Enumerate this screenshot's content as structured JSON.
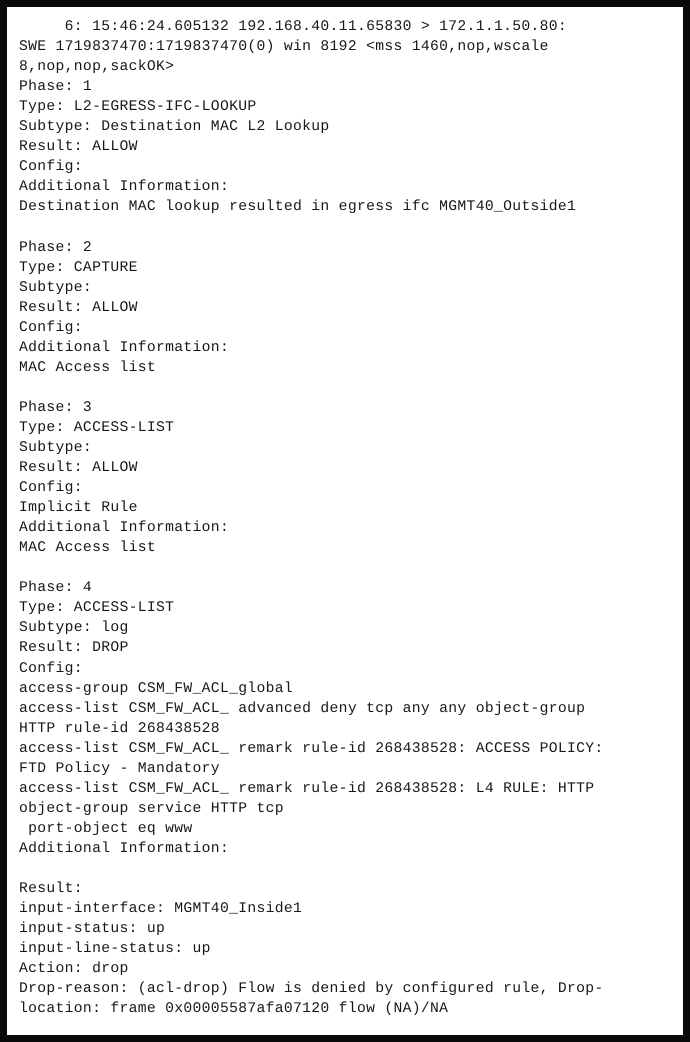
{
  "window": {
    "kind": "terminal-capture",
    "frame_color": "#0a0a0a",
    "background_color": "#ffffff",
    "text_color": "#17171a"
  },
  "console": {
    "lines": [
      "     6: 15:46:24.605132 192.168.40.11.65830 > 172.1.1.50.80:",
      "SWE 1719837470:1719837470(0) win 8192 <mss 1460,nop,wscale",
      "8,nop,nop,sackOK>",
      "Phase: 1",
      "Type: L2-EGRESS-IFC-LOOKUP",
      "Subtype: Destination MAC L2 Lookup",
      "Result: ALLOW",
      "Config:",
      "Additional Information:",
      "Destination MAC lookup resulted in egress ifc MGMT40_Outside1",
      "",
      "Phase: 2",
      "Type: CAPTURE",
      "Subtype:",
      "Result: ALLOW",
      "Config:",
      "Additional Information:",
      "MAC Access list",
      "",
      "Phase: 3",
      "Type: ACCESS-LIST",
      "Subtype:",
      "Result: ALLOW",
      "Config:",
      "Implicit Rule",
      "Additional Information:",
      "MAC Access list",
      "",
      "Phase: 4",
      "Type: ACCESS-LIST",
      "Subtype: log",
      "Result: DROP",
      "Config:",
      "access-group CSM_FW_ACL_global",
      "access-list CSM_FW_ACL_ advanced deny tcp any any object-group",
      "HTTP rule-id 268438528",
      "access-list CSM_FW_ACL_ remark rule-id 268438528: ACCESS POLICY:",
      "FTD Policy - Mandatory",
      "access-list CSM_FW_ACL_ remark rule-id 268438528: L4 RULE: HTTP",
      "object-group service HTTP tcp",
      " port-object eq www",
      "Additional Information:",
      "",
      "Result:",
      "input-interface: MGMT40_Inside1",
      "input-status: up",
      "input-line-status: up",
      "Action: drop",
      "Drop-reason: (acl-drop) Flow is denied by configured rule, Drop-",
      "location: frame 0x00005587afa07120 flow (NA)/NA"
    ],
    "packet": {
      "index": "6",
      "timestamp": "15:46:24.605132",
      "source": "192.168.40.11.65830",
      "direction": ">",
      "destination": "172.1.1.50.80",
      "flags": "SWE",
      "seq": "1719837470:1719837470(0)",
      "payload_len": "0",
      "window": "8192",
      "tcp_options": "<mss 1460,nop,wscale 8,nop,nop,sackOK>"
    },
    "phases": [
      {
        "phase": "1",
        "type": "L2-EGRESS-IFC-LOOKUP",
        "subtype": "Destination MAC L2 Lookup",
        "result": "ALLOW",
        "config": [],
        "additional_information": [
          "Destination MAC lookup resulted in egress ifc MGMT40_Outside1"
        ]
      },
      {
        "phase": "2",
        "type": "CAPTURE",
        "subtype": "",
        "result": "ALLOW",
        "config": [],
        "additional_information": [
          "MAC Access list"
        ]
      },
      {
        "phase": "3",
        "type": "ACCESS-LIST",
        "subtype": "",
        "result": "ALLOW",
        "config": [
          "Implicit Rule"
        ],
        "additional_information": [
          "MAC Access list"
        ]
      },
      {
        "phase": "4",
        "type": "ACCESS-LIST",
        "subtype": "log",
        "result": "DROP",
        "config": [
          "access-group CSM_FW_ACL_global",
          "access-list CSM_FW_ACL_ advanced deny tcp any any object-group HTTP rule-id 268438528",
          "access-list CSM_FW_ACL_ remark rule-id 268438528: ACCESS POLICY: FTD Policy - Mandatory",
          "access-list CSM_FW_ACL_ remark rule-id 268438528: L4 RULE: HTTP",
          "object-group service HTTP tcp",
          " port-object eq www"
        ],
        "additional_information": []
      }
    ],
    "final_result": {
      "heading": "Result:",
      "input_interface_label": "input-interface:",
      "input_interface": "MGMT40_Inside1",
      "input_status_label": "input-status:",
      "input_status": "up",
      "input_line_status_label": "input-line-status:",
      "input_line_status": "up",
      "action_label": "Action:",
      "action": "drop",
      "drop_reason_label": "Drop-reason:",
      "drop_reason": "(acl-drop) Flow is denied by configured rule",
      "drop_location_label": "Drop-location:",
      "drop_location": "frame 0x00005587afa07120 flow (NA)/NA"
    }
  }
}
